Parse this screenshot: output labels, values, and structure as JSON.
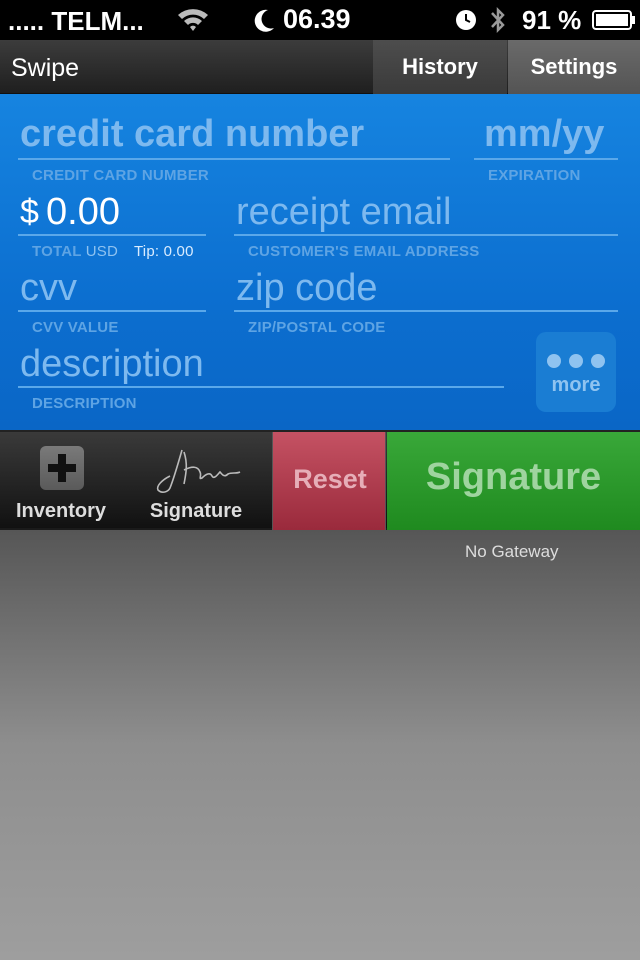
{
  "status_bar": {
    "carrier": "..... TELM...",
    "time": "06.39",
    "battery_percent": "91 %",
    "icons": [
      "wifi-icon",
      "moon-icon",
      "clock-icon",
      "bluetooth-icon",
      "battery-icon"
    ]
  },
  "nav": {
    "title": "Swipe",
    "tabs": [
      {
        "label": "History"
      },
      {
        "label": "Settings"
      }
    ]
  },
  "form": {
    "card_number": {
      "placeholder": "credit card number",
      "caption": "CREDIT CARD NUMBER"
    },
    "expiration": {
      "placeholder": "mm/yy",
      "caption": "EXPIRATION"
    },
    "total": {
      "currency_symbol": "$",
      "value": "0.00",
      "caption": "TOTAL",
      "currency": "USD",
      "tip": "Tip: 0.00"
    },
    "email": {
      "placeholder": "receipt email",
      "caption": "CUSTOMER'S EMAIL ADDRESS"
    },
    "cvv": {
      "placeholder": "cvv",
      "caption": "CVV VALUE"
    },
    "zip": {
      "placeholder": "zip code",
      "caption": "ZIP/POSTAL CODE"
    },
    "description": {
      "placeholder": "description",
      "caption": "DESCRIPTION"
    },
    "more_label": "more"
  },
  "toolbar": {
    "inventory_label": "Inventory",
    "signature_label": "Signature",
    "reset_label": "Reset",
    "signature_button_label": "Signature"
  },
  "content": {
    "gateway_status": "No Gateway"
  },
  "colors": {
    "form_blue": "#0c6fd0",
    "reset_red": "#b03f51",
    "signature_green": "#2e9a2e"
  }
}
